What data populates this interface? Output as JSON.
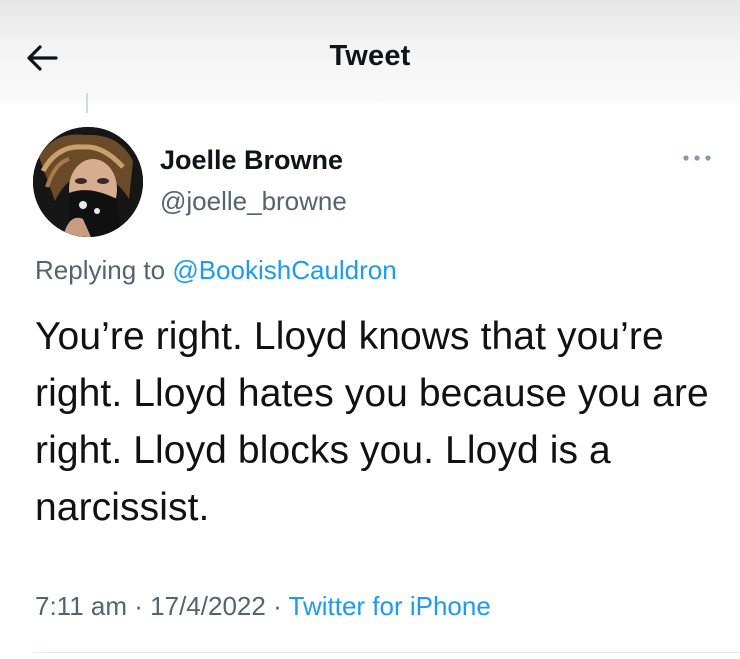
{
  "header": {
    "title": "Tweet"
  },
  "tweet": {
    "author": {
      "display_name": "Joelle Browne",
      "handle": "@joelle_browne"
    },
    "replying_prefix": "Replying to",
    "replying_to": "@BookishCauldron",
    "text": "You’re right. Lloyd knows that you’re right. Lloyd hates you because you are right. Lloyd blocks you. Lloyd is a narcissist.",
    "time": "7:11 am",
    "separator": "·",
    "date": "17/4/2022",
    "source": "Twitter for iPhone"
  },
  "icons": {
    "back": "arrow-left-icon",
    "more": "more-horizontal-icon"
  },
  "colors": {
    "link": "#1d9bf0",
    "secondary_text": "#536471",
    "primary_text": "#0f1419"
  }
}
